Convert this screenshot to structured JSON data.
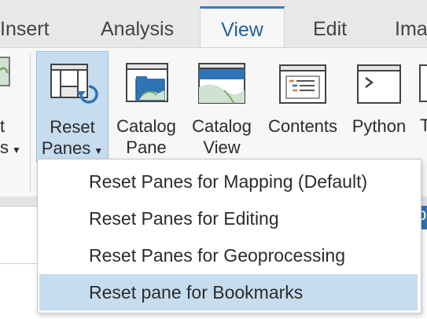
{
  "tabs": [
    {
      "label": "Insert",
      "active": false
    },
    {
      "label": "Analysis",
      "active": false
    },
    {
      "label": "View",
      "active": true
    },
    {
      "label": "Edit",
      "active": false
    },
    {
      "label": "Ima",
      "active": false
    }
  ],
  "ribbon": {
    "left_partial_label_1": "t",
    "left_partial_label_2": "s",
    "reset_panes": {
      "line1": "Reset",
      "line2": "Panes"
    },
    "catalog_pane": {
      "line1": "Catalog",
      "line2": "Pane"
    },
    "catalog_view": {
      "line1": "Catalog",
      "line2": "View"
    },
    "contents": {
      "line1": "Contents"
    },
    "python": {
      "line1": "Python"
    },
    "right_partial_label": "T"
  },
  "menu": {
    "items": [
      {
        "label": "Reset Panes for Mapping (Default)",
        "highlighted": false
      },
      {
        "label": "Reset Panes for Editing",
        "highlighted": false
      },
      {
        "label": "Reset Panes for Geoprocessing",
        "highlighted": false
      },
      {
        "label": "Reset pane for Bookmarks",
        "highlighted": true
      }
    ]
  },
  "right_edge_char": "p",
  "colors": {
    "accent": "#3a78b8",
    "highlight": "#c6dcef",
    "ribbon": "#f7f7f7"
  }
}
